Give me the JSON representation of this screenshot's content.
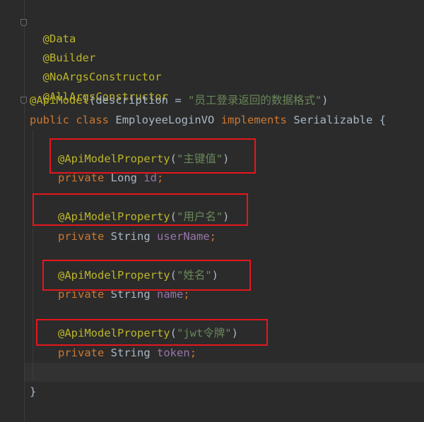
{
  "editor": {
    "annotations": {
      "data": "@Data",
      "builder": "@Builder",
      "no_args": "@NoArgsConstructor",
      "all_args": "@AllArgsConstructor",
      "api_model": "@ApiModel",
      "api_model_property": "@ApiModelProperty"
    },
    "api_model_desc_key": "(description = ",
    "api_model_desc_value": "\"员工登录返回的数据格式\"",
    "api_model_close": ")",
    "class_decl": {
      "kw_public": "public",
      "kw_class": "class",
      "name": "EmployeeLoginVO",
      "kw_implements": "implements",
      "interface": "Serializable",
      "brace": "{"
    },
    "fields": [
      {
        "desc": "\"主键值\"",
        "modifier": "private",
        "type": "Long",
        "name": "id"
      },
      {
        "desc": "\"用户名\"",
        "modifier": "private",
        "type": "String",
        "name": "userName"
      },
      {
        "desc": "\"姓名\"",
        "modifier": "private",
        "type": "String",
        "name": "name"
      },
      {
        "desc": "\"jwt令牌\"",
        "modifier": "private",
        "type": "String",
        "name": "token"
      }
    ],
    "paren_open": "(",
    "paren_close": ")",
    "semicolon": ";",
    "closing_brace": "}"
  },
  "colors": {
    "background": "#2b2b2b",
    "annotation": "#bbb529",
    "keyword": "#cc7832",
    "string": "#6a8759",
    "field": "#9876aa",
    "text": "#a9b7c6",
    "highlight_box": "#e5171d"
  }
}
